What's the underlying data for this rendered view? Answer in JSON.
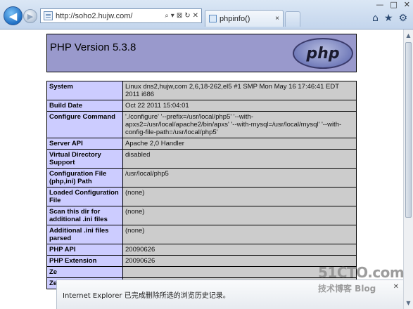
{
  "browser": {
    "url": "http://soho2.hujw.com/",
    "tab_title": "phpinfo()",
    "tab_close": "×",
    "address_tools": [
      "⌕",
      "▾",
      "⊠",
      "↻",
      "✕"
    ],
    "window_controls": [
      "—",
      "□",
      "✕"
    ],
    "command_icons": [
      "⌂",
      "★",
      "⚙"
    ]
  },
  "page": {
    "title": "PHP Version 5.3.8",
    "logo_text": "php"
  },
  "info_rows": [
    {
      "name": "System",
      "value": "Linux dns2,hujw,com 2,6,18-262,el5 #1 SMP Mon May 16 17:46:41 EDT 2011 i686"
    },
    {
      "name": "Build Date",
      "value": "Oct 22 2011 15:04:01"
    },
    {
      "name": "Configure Command",
      "value": "'./configure' '--prefix=/usr/local/php5' '--with-apxs2=/usr/local/apache2/bin/apxs' '--with-mysql=/usr/local/mysql' '--with-config-file-path=/usr/local/php5'"
    },
    {
      "name": "Server API",
      "value": "Apache 2,0 Handler"
    },
    {
      "name": "Virtual Directory Support",
      "value": "disabled"
    },
    {
      "name": "Configuration File (php,ini) Path",
      "value": "/usr/local/php5"
    },
    {
      "name": "Loaded Configuration File",
      "value": "(none)"
    },
    {
      "name": "Scan this dir for additional .ini files",
      "value": "(none)"
    },
    {
      "name": "Additional .ini files parsed",
      "value": "(none)"
    },
    {
      "name": "PHP API",
      "value": "20090626"
    },
    {
      "name": "PHP Extension",
      "value": "20090626"
    },
    {
      "name": "Ze",
      "value": ""
    },
    {
      "name": "Ze",
      "value": ""
    }
  ],
  "notification": {
    "message": "Internet Explorer 已完成删除所选的浏览历史记录。",
    "close": "✕"
  },
  "watermark": {
    "top": "51CTO.com",
    "bottom": "技术博客  Blog"
  }
}
